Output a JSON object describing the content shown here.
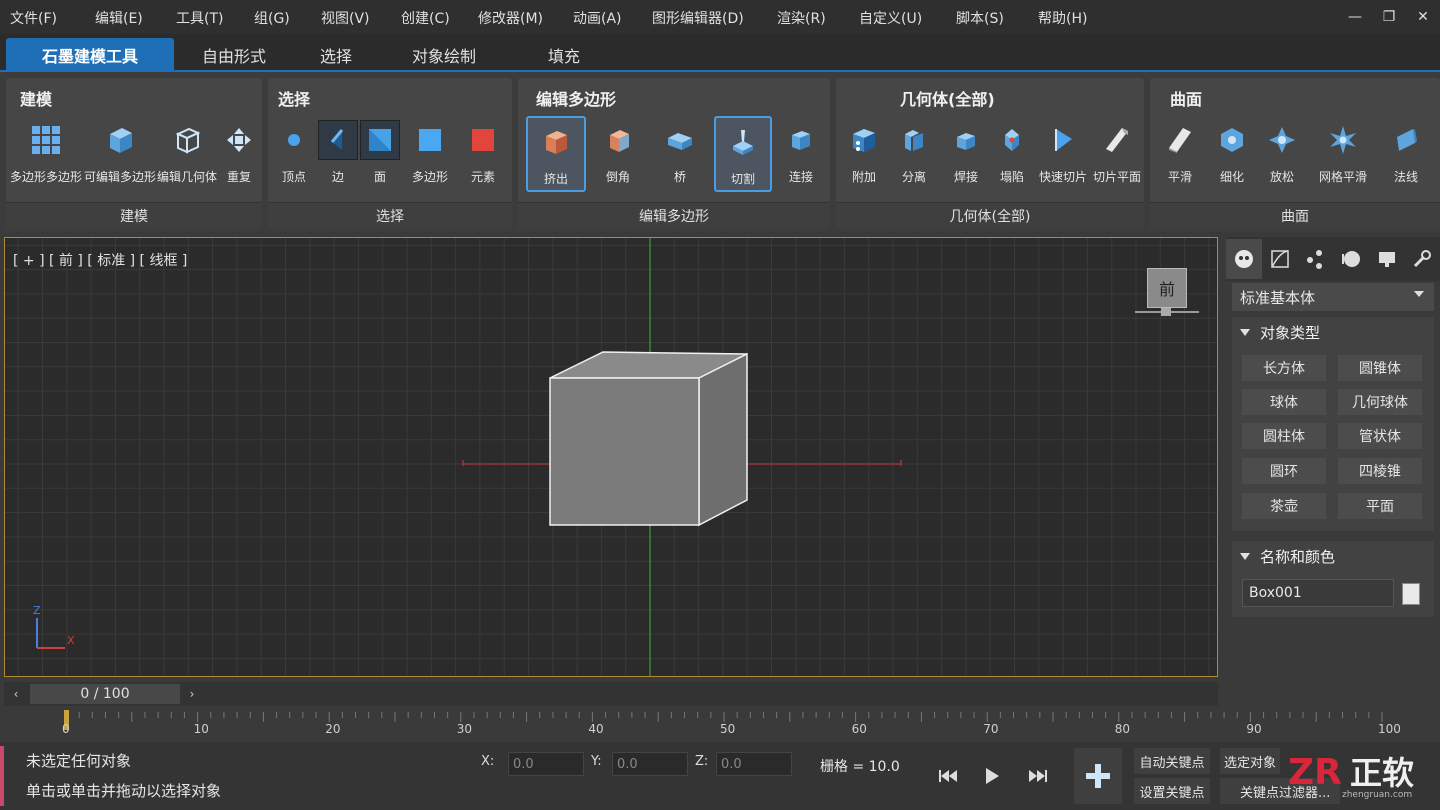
{
  "menu": [
    "文件(F)",
    "编辑(E)",
    "工具(T)",
    "组(G)",
    "视图(V)",
    "创建(C)",
    "修改器(M)",
    "动画(A)",
    "图形编辑器(D)",
    "渲染(R)",
    "自定义(U)",
    "脚本(S)",
    "帮助(H)"
  ],
  "window_controls": [
    "—",
    "❐",
    "✕"
  ],
  "ribbon_tabs": [
    "石墨建模工具",
    "自由形式",
    "选择",
    "对象绘制",
    "填充"
  ],
  "groups": {
    "modeling": {
      "title": "建模",
      "footer": "建模",
      "buttons": [
        "多边形多边形",
        "可编辑多边形",
        "编辑几何体",
        "重复"
      ]
    },
    "selection": {
      "title": "选择",
      "footer": "选择",
      "buttons": [
        "顶点",
        "边",
        "面",
        "多边形",
        "元素"
      ]
    },
    "edit_poly": {
      "title": "编辑多边形",
      "footer": "编辑多边形",
      "buttons": [
        "挤出",
        "倒角",
        "桥",
        "切割",
        "连接"
      ]
    },
    "geometry": {
      "title": "几何体(全部)",
      "footer": "几何体(全部)",
      "buttons": [
        "附加",
        "分离",
        "焊接",
        "塌陷",
        "快速切片",
        "切片平面"
      ]
    },
    "surface": {
      "title": "曲面",
      "footer": "曲面",
      "buttons": [
        "平滑",
        "细化",
        "放松",
        "网格平滑",
        "法线"
      ]
    }
  },
  "viewport": {
    "label": "[ + ] [ 前 ] [ 标准 ] [ 线框 ]",
    "viewcube": "前",
    "axis_z": "Z",
    "axis_x": "X"
  },
  "panel": {
    "dropdown": "标准基本体",
    "object_type_title": "对象类型",
    "object_types": [
      "长方体",
      "圆锥体",
      "球体",
      "几何球体",
      "圆柱体",
      "管状体",
      "圆环",
      "四棱锥",
      "茶壶",
      "平面"
    ],
    "name_color_title": "名称和颜色",
    "object_name": "Box001",
    "object_color": "#e8e8e8"
  },
  "timeline": {
    "range": "0 / 100",
    "ticks": [
      "0",
      "10",
      "20",
      "30",
      "40",
      "50",
      "60",
      "70",
      "80",
      "90",
      "100"
    ]
  },
  "status": {
    "line1": "未选定任何对象",
    "line2": "单击或单击并拖动以选择对象",
    "x_label": "X:",
    "y_label": "Y:",
    "z_label": "Z:",
    "x_val": "0.0",
    "y_val": "0.0",
    "z_val": "0.0",
    "grid": "栅格 = 10.0",
    "auto_key": "自动关键点",
    "set_key": "设置关键点",
    "selected": "选定对象",
    "key_filter": "关键点过滤器..."
  },
  "watermark": {
    "brand": "正软",
    "domain": "zhengruan.com"
  },
  "colors": {
    "accent": "#1f6fb7",
    "viewport_border": "#b08a2c",
    "x_axis": "#c83c3c",
    "y_axis": "#3cb43c"
  }
}
